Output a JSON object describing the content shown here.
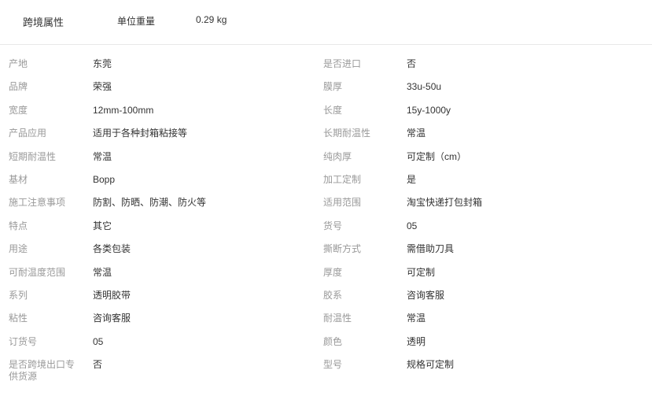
{
  "cross_border": {
    "title": "跨境属性",
    "label": "单位重量",
    "value": "0.29 kg"
  },
  "attributes": [
    [
      {
        "label": "产地",
        "value": "东莞"
      },
      {
        "label": "是否进口",
        "value": "否"
      }
    ],
    [
      {
        "label": "品牌",
        "value": "荣强"
      },
      {
        "label": "膜厚",
        "value": "33u-50u"
      }
    ],
    [
      {
        "label": "宽度",
        "value": "12mm-100mm"
      },
      {
        "label": "长度",
        "value": "15y-1000y"
      }
    ],
    [
      {
        "label": "产品应用",
        "value": "适用于各种封箱粘接等"
      },
      {
        "label": "长期耐温性",
        "value": "常温"
      }
    ],
    [
      {
        "label": "短期耐温性",
        "value": "常温"
      },
      {
        "label": "纯肉厚",
        "value": "可定制（cm）"
      }
    ],
    [
      {
        "label": "基材",
        "value": "Bopp"
      },
      {
        "label": "加工定制",
        "value": "是"
      }
    ],
    [
      {
        "label": "施工注意事项",
        "value": "防割、防晒、防潮、防火等"
      },
      {
        "label": "适用范围",
        "value": "淘宝快递打包封箱"
      }
    ],
    [
      {
        "label": "特点",
        "value": "其它"
      },
      {
        "label": "货号",
        "value": "05"
      }
    ],
    [
      {
        "label": "用途",
        "value": "各类包装"
      },
      {
        "label": "撕断方式",
        "value": "需借助刀具"
      }
    ],
    [
      {
        "label": "可耐温度范围",
        "value": "常温"
      },
      {
        "label": "厚度",
        "value": "可定制"
      }
    ],
    [
      {
        "label": "系列",
        "value": "透明胶带"
      },
      {
        "label": "胶系",
        "value": "咨询客服"
      }
    ],
    [
      {
        "label": "粘性",
        "value": "咨询客服"
      },
      {
        "label": "耐温性",
        "value": "常温"
      }
    ],
    [
      {
        "label": "订货号",
        "value": "05"
      },
      {
        "label": "颜色",
        "value": "透明"
      }
    ],
    [
      {
        "label": "是否跨境出口专供货源",
        "value": "否"
      },
      {
        "label": "型号",
        "value": "规格可定制"
      }
    ]
  ]
}
